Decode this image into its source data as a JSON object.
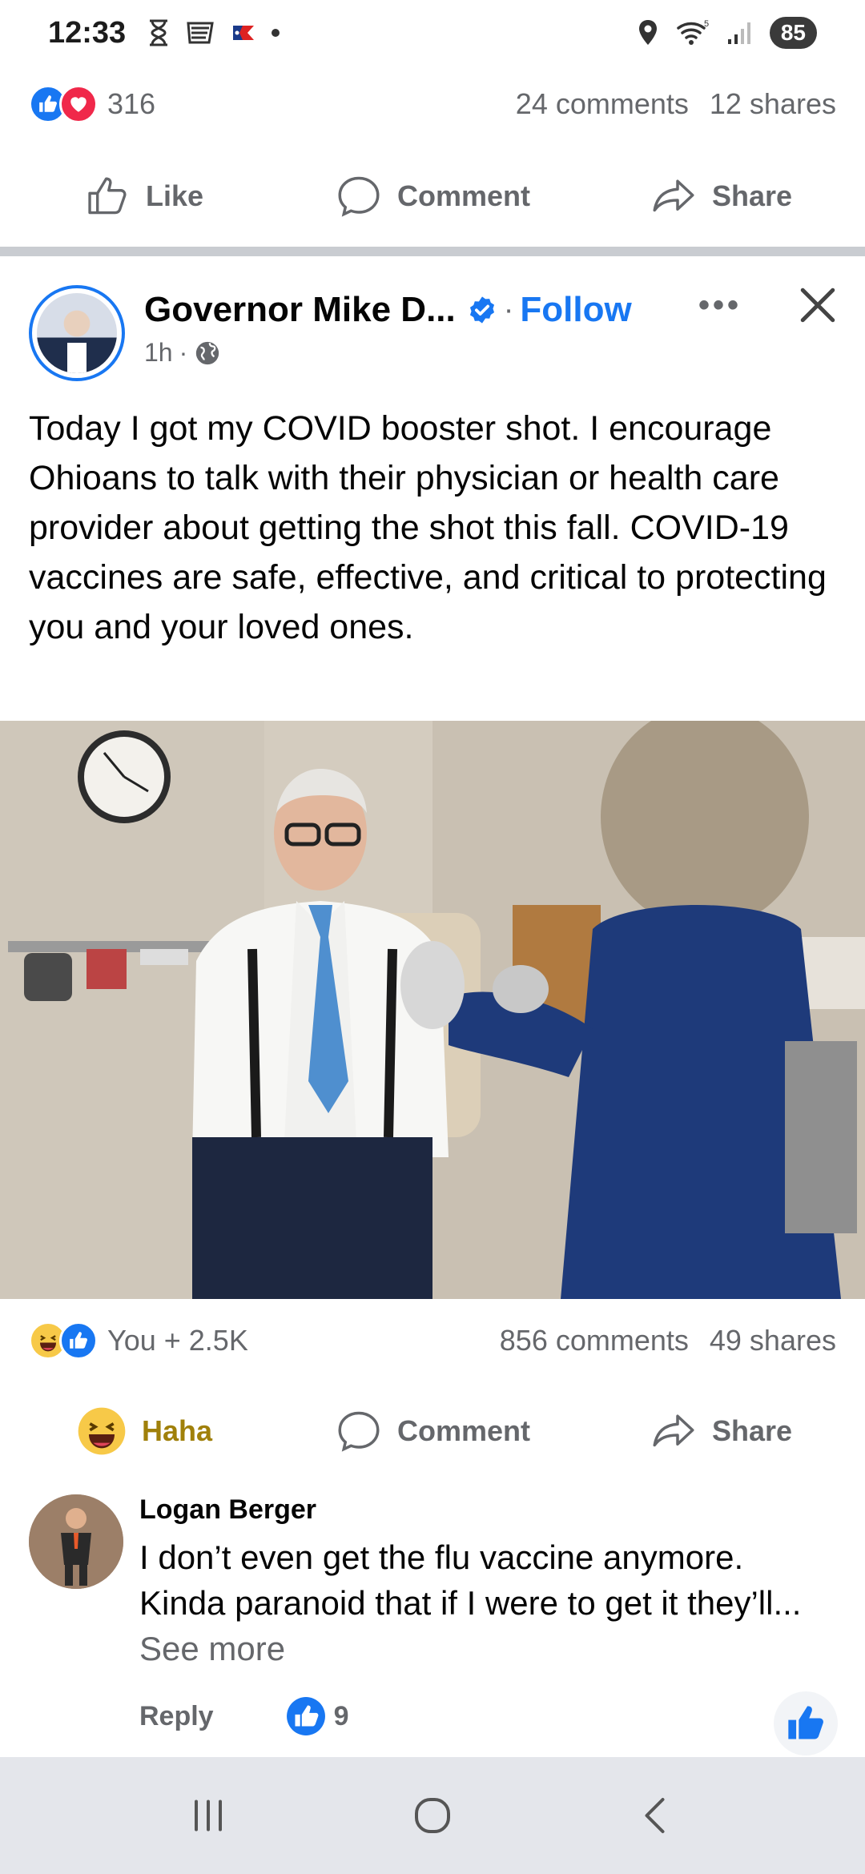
{
  "status_bar": {
    "time": "12:33",
    "battery": "85"
  },
  "prev_post": {
    "reaction_count": "316",
    "comments": "24 comments",
    "shares": "12 shares",
    "actions": {
      "like": "Like",
      "comment": "Comment",
      "share": "Share"
    }
  },
  "post": {
    "author": "Governor Mike D...",
    "follow": "Follow",
    "separator": "·",
    "time": "1h",
    "meta_separator": "·",
    "text": "Today I got my COVID booster shot. I encourage Ohioans to talk with their physician or health care provider about getting the shot this fall. COVID-19 vaccines are safe, effective, and critical to protecting you and your loved ones.",
    "reaction_summary": "You + 2.5K",
    "comments": "856 comments",
    "shares": "49 shares",
    "actions": {
      "reaction": "Haha",
      "comment": "Comment",
      "share": "Share"
    }
  },
  "comment": {
    "author": "Logan Berger",
    "text": "I don’t even get the flu vaccine anymore. Kinda paranoid that if I were to get it they’ll...",
    "see_more": "See more",
    "reply": "Reply",
    "like_count": "9"
  },
  "colors": {
    "brand_blue": "#1877f2",
    "secondary_text": "#65676b",
    "haha_text": "#a0800a"
  }
}
